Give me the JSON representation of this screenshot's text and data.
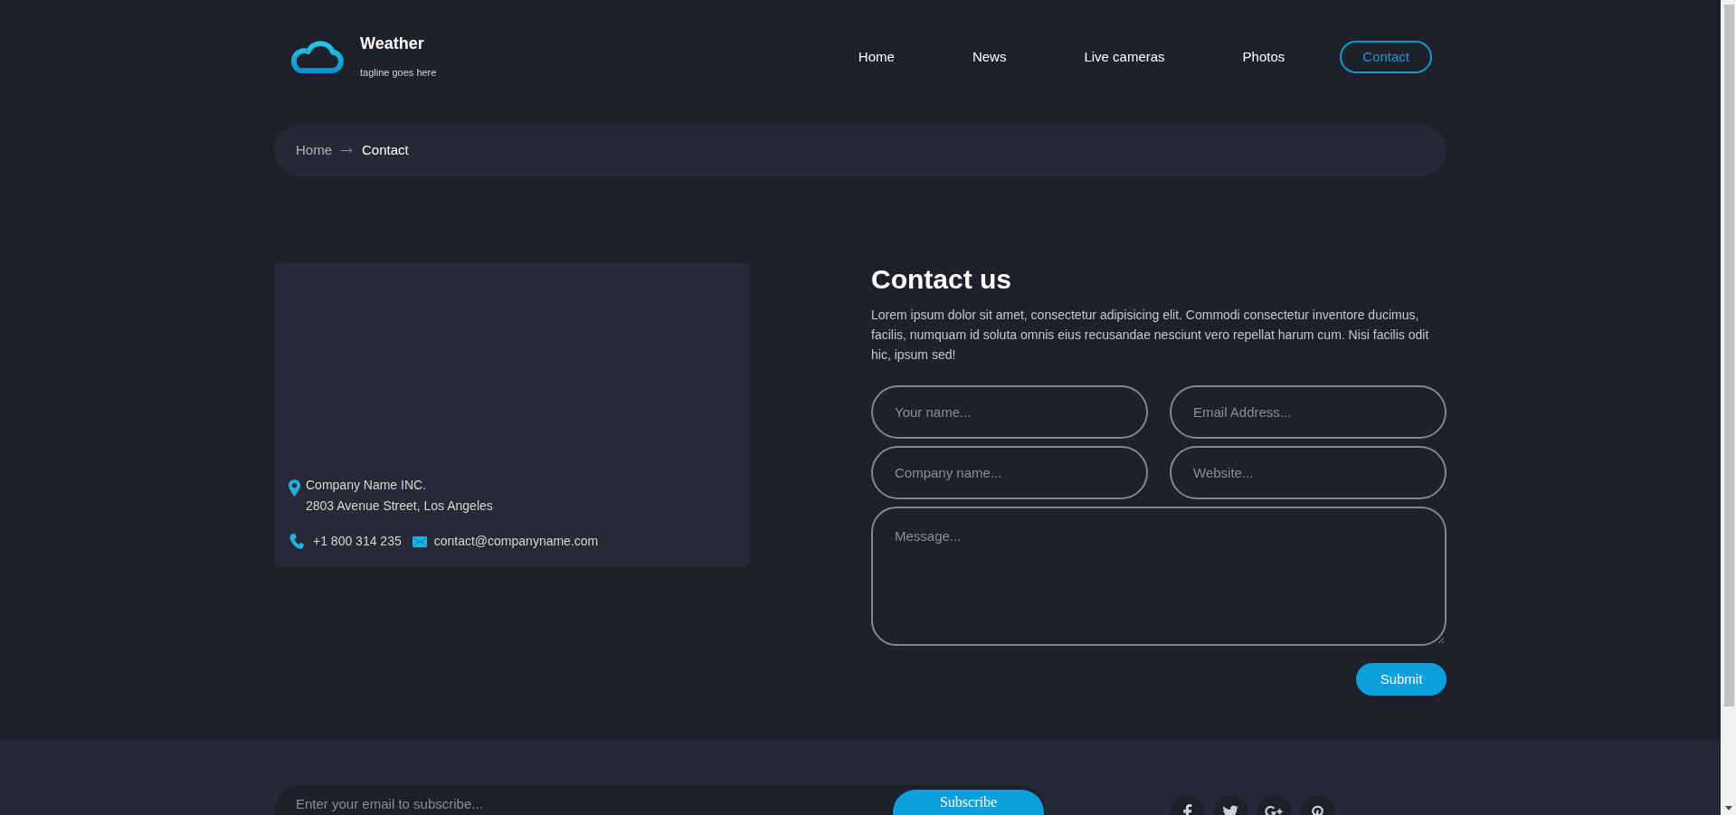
{
  "header": {
    "logo": {
      "title": "Weather",
      "tagline": "tagline goes here"
    },
    "nav": [
      {
        "label": "Home",
        "selected": false
      },
      {
        "label": "News",
        "selected": false
      },
      {
        "label": "Live cameras",
        "selected": false
      },
      {
        "label": "Photos",
        "selected": false
      },
      {
        "label": "Contact",
        "selected": true
      }
    ]
  },
  "breadcrumb": [
    {
      "label": "Home",
      "current": false
    },
    {
      "label": "Contact",
      "current": true
    }
  ],
  "contact_card": {
    "company": "Company Name INC.",
    "address": "2803 Avenue Street, Los Angeles",
    "phone": "+1 800 314 235",
    "email": "contact@companyname.com"
  },
  "contact_form": {
    "title": "Contact us",
    "text": "Lorem ipsum dolor sit amet, consectetur adipisicing elit. Commodi consectetur inventore ducimus, facilis, numquam id soluta omnis eius recusandae nesciunt vero repellat harum cum. Nisi facilis odit hic, ipsum sed!",
    "fields": [
      {
        "kind": "input",
        "placeholder": "Your name..."
      },
      {
        "kind": "input",
        "placeholder": "Email Address..."
      },
      {
        "kind": "input",
        "placeholder": "Company name..."
      },
      {
        "kind": "input",
        "placeholder": "Website..."
      },
      {
        "kind": "textarea",
        "placeholder": "Message..."
      }
    ],
    "submit": "Submit"
  },
  "footer": {
    "subscribe": {
      "placeholder": "Enter your email to subscribe...",
      "button": "Subscribe"
    },
    "social": [
      {
        "kind": "facebook"
      },
      {
        "kind": "twitter"
      },
      {
        "kind": "googleplus"
      },
      {
        "kind": "pinterest"
      }
    ]
  }
}
